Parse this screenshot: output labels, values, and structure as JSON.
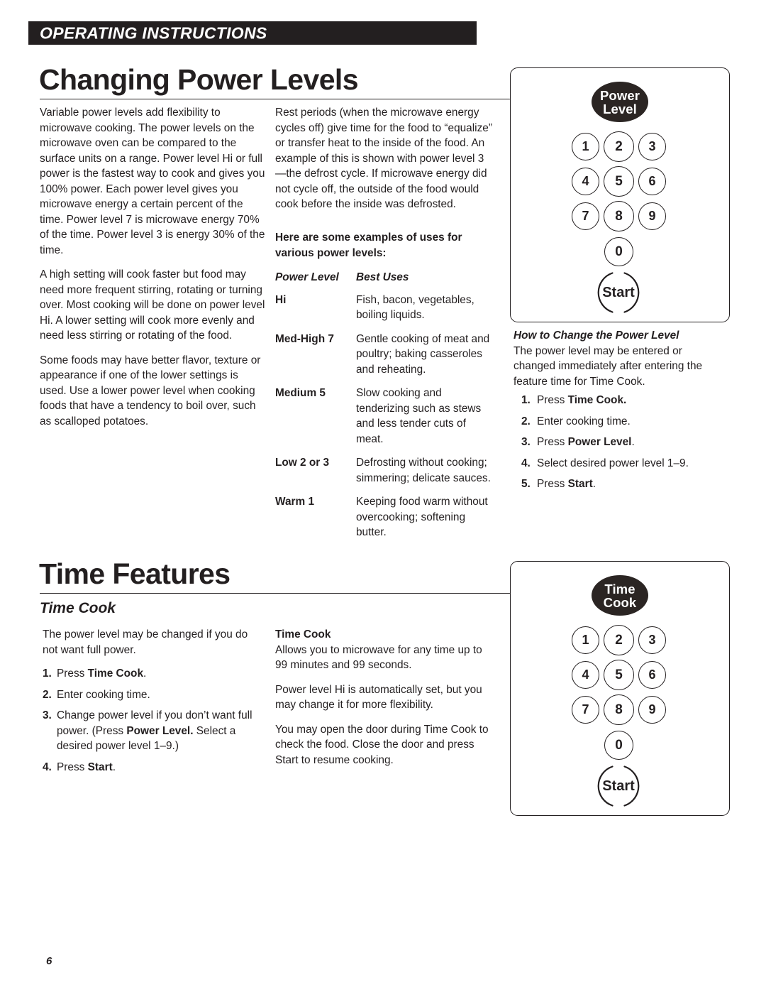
{
  "banner": {
    "label": "OPERATING INSTRUCTIONS"
  },
  "section1": {
    "title": "Changing Power Levels",
    "left_column": {
      "p1": "Variable power levels add flexibility to microwave cooking. The power levels on the microwave oven can be compared to the surface units on a range. Power level Hi or full power is the fastest way to cook and gives you 100% power. Each power level gives you microwave energy a certain percent of the time. Power level 7 is microwave energy 70% of the time. Power level 3 is energy 30% of the time.",
      "p2": "A high setting will cook faster but food may need more frequent stirring, rotating or turning over. Most cooking will be done on power level Hi. A lower setting will cook more evenly and need less stirring or rotating of the food.",
      "p3": "Some foods may have better flavor, texture or appearance if one of the lower settings is used. Use a lower power level when cooking foods that have a tendency to boil over, such as scalloped potatoes."
    },
    "middle_column": {
      "p1": "Rest periods (when the microwave energy cycles off) give time for the food to “equalize” or transfer heat to the inside of the food. An example of this is shown with power level 3—the defrost cycle. If microwave energy did not cycle off, the outside of the food would cook before the inside was defrosted.",
      "uses_intro": "Here are some examples of uses for various power levels:",
      "uses_header": {
        "level": "Power Level",
        "best_uses": "Best Uses"
      },
      "uses_rows": [
        {
          "level": "Hi",
          "best_uses": "Fish, bacon, vegetables, boiling liquids."
        },
        {
          "level": "Med-High 7",
          "best_uses": "Gentle cooking of meat and poultry; baking casseroles and reheating."
        },
        {
          "level": "Medium 5",
          "best_uses": "Slow cooking and tenderizing such as stews and less tender cuts of meat."
        },
        {
          "level": "Low 2 or 3",
          "best_uses": "Defrosting without cooking; simmering; delicate sauces."
        },
        {
          "level": "Warm 1",
          "best_uses": "Keeping food warm without overcooking; softening butter."
        }
      ]
    },
    "panel": {
      "feature_label_line1": "Power",
      "feature_label_line2": "Level",
      "keys": [
        "1",
        "2",
        "3",
        "4",
        "5",
        "6",
        "7",
        "8",
        "9",
        "0"
      ],
      "start_label": "Start"
    },
    "how_to": {
      "heading": "How to Change the Power Level",
      "intro": "The power level may be entered or changed immediately after entering the feature time for Time Cook.",
      "steps": [
        {
          "num": "1.",
          "pre": "Press ",
          "bold": "Time Cook.",
          "post": ""
        },
        {
          "num": "2.",
          "pre": "Enter cooking time.",
          "bold": "",
          "post": ""
        },
        {
          "num": "3.",
          "pre": "Press ",
          "bold": "Power Level",
          "post": "."
        },
        {
          "num": "4.",
          "pre": "Select desired power level 1–9.",
          "bold": "",
          "post": ""
        },
        {
          "num": "5.",
          "pre": "Press ",
          "bold": "Start",
          "post": "."
        }
      ]
    }
  },
  "section2": {
    "title": "Time Features",
    "subtitle": "Time Cook",
    "left_column": {
      "p1": "The power level may be changed if you do not want full power.",
      "steps": [
        {
          "num": "1.",
          "pre": "Press ",
          "bold": "Time Cook",
          "post": "."
        },
        {
          "num": "2.",
          "pre": "Enter cooking time.",
          "bold": "",
          "post": ""
        },
        {
          "num": "3.",
          "pre": "Change power level if you don’t want full power. (Press ",
          "bold": "Power Level.",
          "post": " Select a desired power level 1–9.)"
        },
        {
          "num": "4.",
          "pre": "Press ",
          "bold": "Start",
          "post": "."
        }
      ]
    },
    "middle_column": {
      "heading": "Time Cook",
      "p1": "Allows you to microwave for any time up to 99 minutes and 99 seconds.",
      "p2": "Power level Hi is automatically set, but you may change it for more flexibility.",
      "p3": "You may open the door during Time Cook to check the food. Close the door and press Start to resume cooking."
    },
    "panel": {
      "feature_label_line1": "Time",
      "feature_label_line2": "Cook",
      "keys": [
        "1",
        "2",
        "3",
        "4",
        "5",
        "6",
        "7",
        "8",
        "9",
        "0"
      ],
      "start_label": "Start"
    }
  },
  "footer": {
    "page_number": "6"
  },
  "colors": {
    "ink": "#231f20",
    "banner_bg": "#231f20",
    "oval_bg": "#2b2523",
    "paper": "#ffffff"
  }
}
